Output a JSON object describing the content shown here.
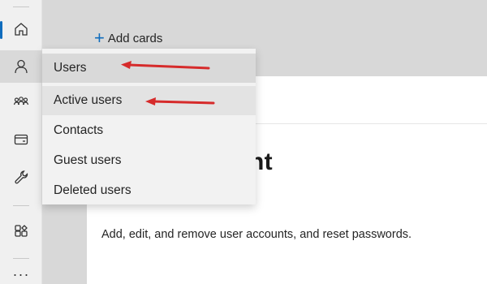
{
  "header": {
    "add_cards_label": "Add cards"
  },
  "rail": {
    "items": [
      {
        "name": "home-icon"
      },
      {
        "name": "user-icon"
      },
      {
        "name": "groups-icon"
      },
      {
        "name": "billing-icon"
      },
      {
        "name": "wrench-icon"
      },
      {
        "name": "apps-icon"
      },
      {
        "name": "more-icon",
        "glyph": "···"
      }
    ]
  },
  "flyout": {
    "items": [
      {
        "label": "Users"
      },
      {
        "label": "Active users"
      },
      {
        "label": "Contacts"
      },
      {
        "label": "Guest users"
      },
      {
        "label": "Deleted users"
      }
    ]
  },
  "card": {
    "title_partial": "ement",
    "description": "Add, edit, and remove user accounts, and reset passwords."
  },
  "colors": {
    "accent": "#0f6cbd",
    "annotation": "#d62b2b"
  }
}
